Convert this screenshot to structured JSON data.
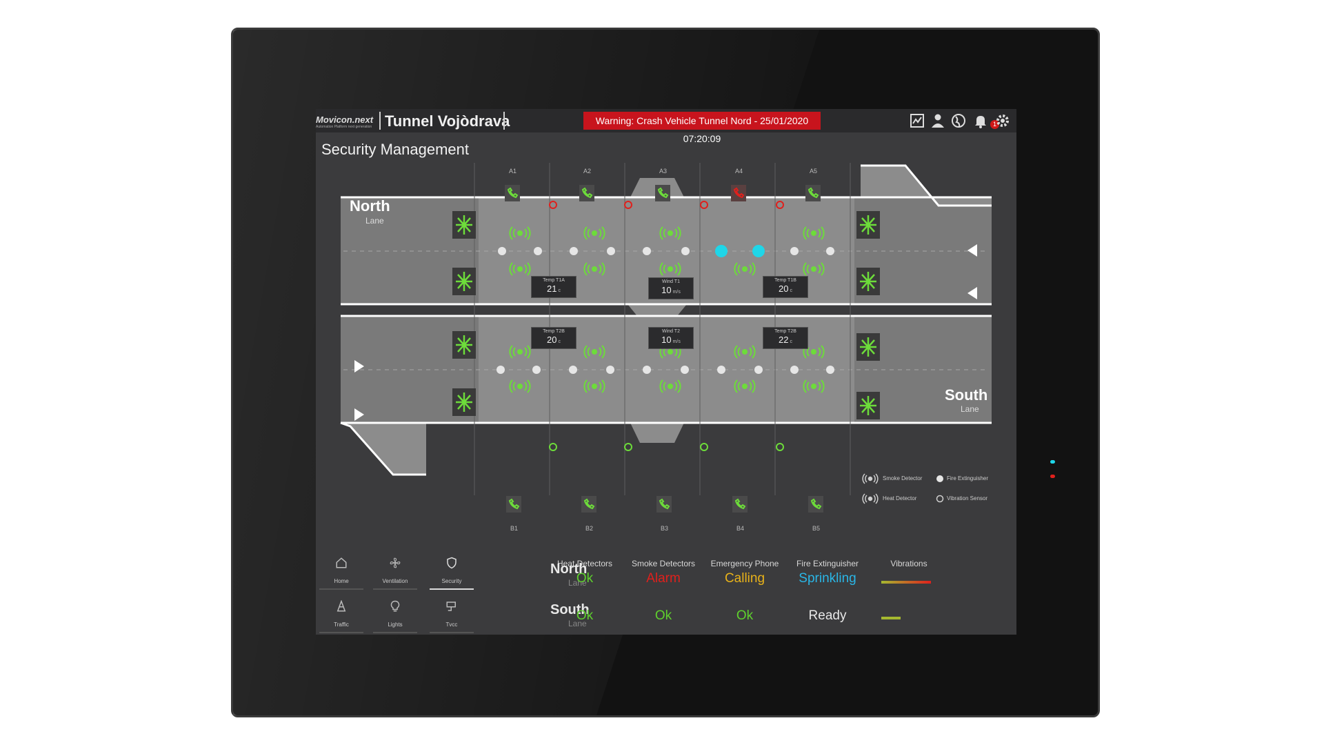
{
  "app": {
    "logo_text": "Movicon.next",
    "logo_sub": "Automation Platform next generation",
    "title": "Tunnel Vojòdrava",
    "warning": "Warning: Crash Vehicle Tunnel Nord - 25/01/2020 07:20:09",
    "notification_count": "1"
  },
  "page": {
    "title": "Security Management"
  },
  "tunnel": {
    "north": {
      "name": "North",
      "sub": "Lane"
    },
    "south": {
      "name": "South",
      "sub": "Lane"
    },
    "top_columns": [
      "A1",
      "A2",
      "A3",
      "A4",
      "A5"
    ],
    "bottom_columns": [
      "B1",
      "B2",
      "B3",
      "B4",
      "B5"
    ],
    "sensors": {
      "t1a": {
        "name": "Temp T1A",
        "value": "21",
        "unit": "c"
      },
      "w1": {
        "name": "Wind T1",
        "value": "10",
        "unit": "m/s"
      },
      "t1b": {
        "name": "Temp T1B",
        "value": "20",
        "unit": "c"
      },
      "t2b_left": {
        "name": "Temp T2B",
        "value": "20",
        "unit": "c"
      },
      "w2": {
        "name": "Wind T2",
        "value": "10",
        "unit": "m/s"
      },
      "t2b_right": {
        "name": "Temp T2B",
        "value": "22",
        "unit": "c"
      }
    }
  },
  "legend": {
    "smoke": "Smoke Detector",
    "heat": "Heat Detector",
    "extinguisher": "Fire Extinguisher",
    "vibration": "Vibration Sensor"
  },
  "nav": [
    {
      "label": "Home",
      "icon": "home-icon"
    },
    {
      "label": "Ventilation",
      "icon": "fan-icon"
    },
    {
      "label": "Security",
      "icon": "shield-icon"
    },
    {
      "label": "Traffic",
      "icon": "cone-icon"
    },
    {
      "label": "Lights",
      "icon": "bulb-icon"
    },
    {
      "label": "Tvcc",
      "icon": "camera-icon"
    }
  ],
  "status": {
    "headers": [
      "Heat Detectors",
      "Smoke Detectors",
      "Emergency Phone",
      "Fire Extinguisher",
      "Vibrations"
    ],
    "north": {
      "lane": "North",
      "sub": "Lane",
      "heat": "Ok",
      "smoke": "Alarm",
      "phone": "Calling",
      "extinguisher": "Sprinkling"
    },
    "south": {
      "lane": "South",
      "sub": "Lane",
      "heat": "Ok",
      "smoke": "Ok",
      "phone": "Ok",
      "extinguisher": "Ready"
    }
  },
  "colors": {
    "ok": "#5fd12d",
    "alarm": "#e0201c",
    "calling": "#e8b21a",
    "sprinkling": "#2ab6e6",
    "ready": "#e8e8e8",
    "warning_bg": "#c8141d",
    "detector": "#5fd12d",
    "active_point": "#1fd6e8"
  }
}
